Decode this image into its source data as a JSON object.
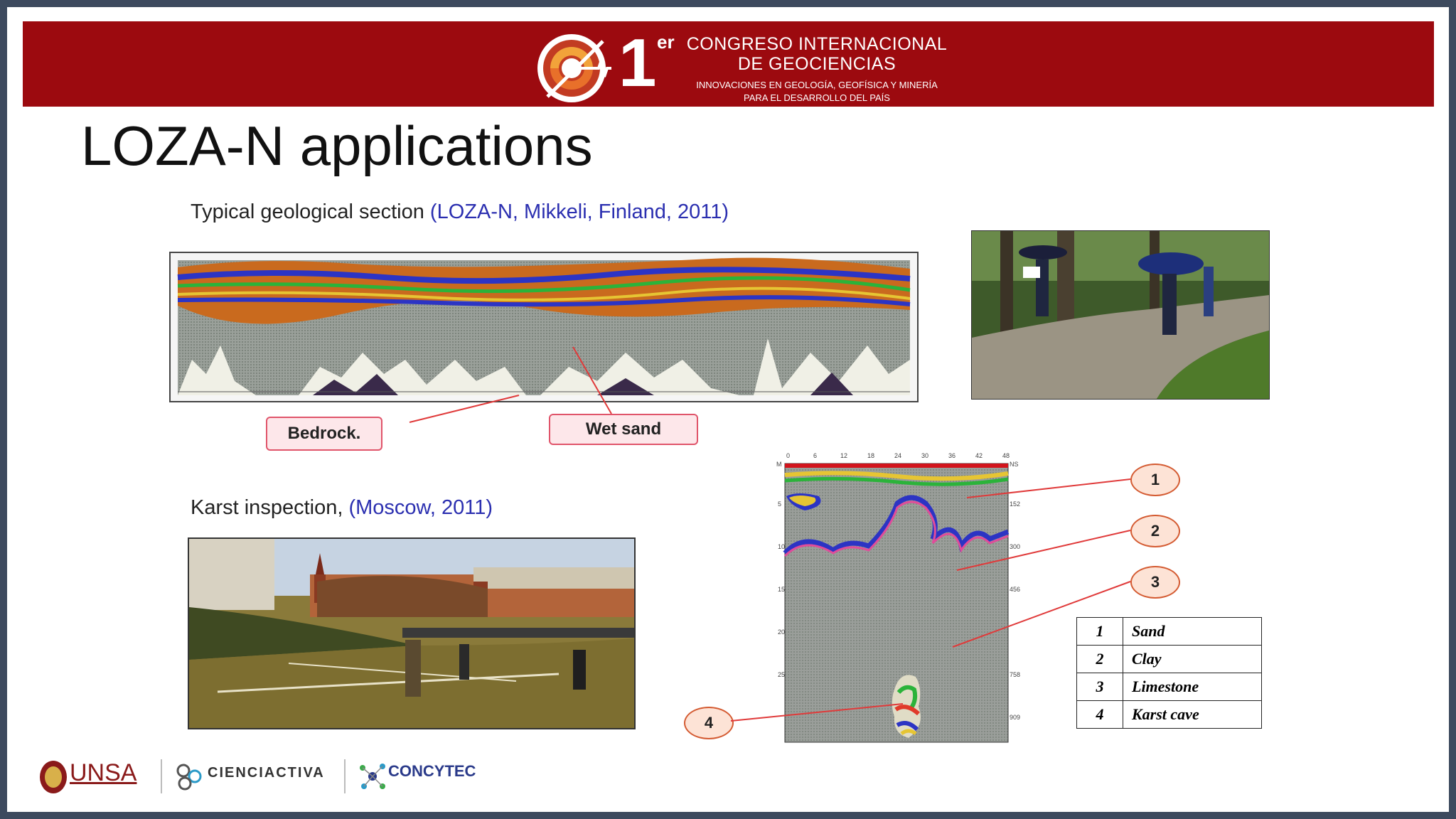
{
  "header": {
    "logo_number": "1",
    "logo_superscript": "er",
    "line1": "CONGRESO INTERNACIONAL",
    "line2": "DE GEOCIENCIAS",
    "line3": "INNOVACIONES EN GEOLOGÍA, GEOFÍSICA Y MINERÍA",
    "line4": "PARA EL DESARROLLO DEL PAÍS",
    "colors": {
      "bar": "#9c0a0f",
      "frame": "#3d4a5e"
    }
  },
  "title": "LOZA-N applications",
  "section_top": {
    "caption_black": "Typical geological section ",
    "caption_blue": "(LOZA-N, Mikkeli, Finland, 2011)",
    "callouts": {
      "bedrock": "Bedrock.",
      "wet_sand": "Wet sand"
    }
  },
  "section_bottom": {
    "caption_black": "Karst inspection, ",
    "caption_blue": "(Moscow, 2011)",
    "circle_labels": [
      "1",
      "2",
      "3",
      "4"
    ],
    "legend": [
      {
        "num": "1",
        "name": "Sand"
      },
      {
        "num": "2",
        "name": "Clay"
      },
      {
        "num": "3",
        "name": "Limestone"
      },
      {
        "num": "4",
        "name": "Karst cave"
      }
    ],
    "radargram_ticks_top": [
      "0",
      "6",
      "12",
      "18",
      "24",
      "30",
      "36",
      "42",
      "48"
    ],
    "radargram_unit_left": "M",
    "radargram_unit_right": "NS",
    "radargram_depth_left": [
      "5",
      "10",
      "15",
      "20",
      "25"
    ],
    "radargram_depth_right": [
      "152",
      "300",
      "456",
      "758",
      "909"
    ]
  },
  "footer": {
    "unsa": "UNSA",
    "cienciactiva": "CIENCIACTIVA",
    "concytec": "CONCYTEC"
  }
}
